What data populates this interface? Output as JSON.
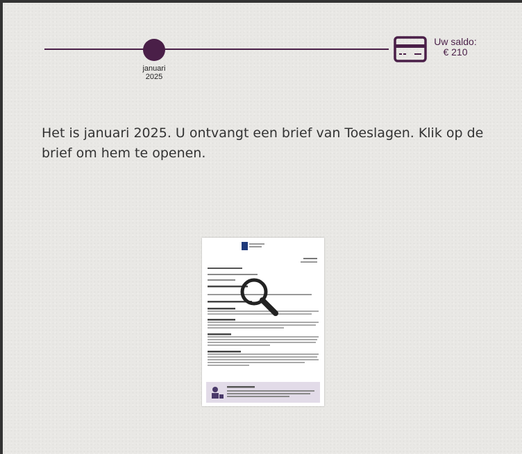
{
  "timeline": {
    "month": "januari",
    "year": "2025"
  },
  "balance": {
    "label": "Uw saldo:",
    "amount": "€ 210",
    "icon": "credit-card-icon"
  },
  "instruction": "Het is januari 2025. U ontvangt een brief van Toeslagen. Klik op de brief om hem te openen.",
  "letter": {
    "icon": "magnifier-icon"
  },
  "colors": {
    "accent": "#4a1f48",
    "background": "#e9e8e5",
    "border": "#333333"
  }
}
